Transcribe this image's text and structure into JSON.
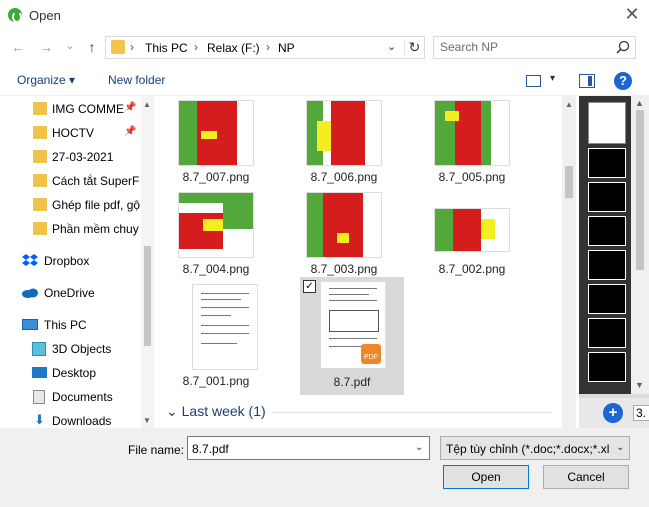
{
  "window": {
    "title": "Open",
    "close": "✕"
  },
  "nav": {
    "back": "←",
    "forward": "→",
    "recent": "⌄",
    "up": "↑"
  },
  "address": {
    "crumbs": [
      "This PC",
      "Relax (F:)",
      "NP"
    ],
    "sep": "›",
    "dropdown": "⌄",
    "refresh": "↻"
  },
  "search": {
    "placeholder": "Search NP"
  },
  "toolbar": {
    "organize": "Organize ▾",
    "new_folder": "New folder",
    "help": "?",
    "view_dd": "▾"
  },
  "sidebar": {
    "items": [
      {
        "label": "IMG COMME",
        "pinned": true
      },
      {
        "label": "HOCTV",
        "pinned": true
      },
      {
        "label": "27-03-2021",
        "pinned": false
      },
      {
        "label": "Cách tắt SuperFe",
        "pinned": false
      },
      {
        "label": "Ghép file pdf, gộ",
        "pinned": false
      },
      {
        "label": "Phần mềm chuy",
        "pinned": false
      },
      {
        "label": "Dropbox"
      },
      {
        "label": "OneDrive"
      },
      {
        "label": "This PC"
      },
      {
        "label": "3D Objects"
      },
      {
        "label": "Desktop"
      },
      {
        "label": "Documents"
      },
      {
        "label": "Downloads"
      }
    ],
    "pin_glyph": "📌",
    "scroll_up": "▲",
    "scroll_down": "▼"
  },
  "files": [
    {
      "name": "8.7_007.png",
      "kind": "sheet"
    },
    {
      "name": "8.7_006.png",
      "kind": "sheet"
    },
    {
      "name": "8.7_005.png",
      "kind": "sheet"
    },
    {
      "name": "8.7_004.png",
      "kind": "sheet"
    },
    {
      "name": "8.7_003.png",
      "kind": "sheet"
    },
    {
      "name": "8.7_002.png",
      "kind": "sheet"
    },
    {
      "name": "8.7_001.png",
      "kind": "doc"
    },
    {
      "name": "8.7.pdf",
      "kind": "pdf",
      "selected": true,
      "checked": "✓",
      "badge": "PDF"
    }
  ],
  "group": {
    "label": "Last week (1)",
    "chevron": "⌄"
  },
  "preview": {
    "zoom_plus": "+",
    "zoom_value": "3."
  },
  "bottom": {
    "file_name_label": "File name:",
    "file_name_value": "8.7.pdf",
    "file_type": "Tệp tùy chỉnh (*.doc;*.docx;*.xl",
    "dd": "⌄",
    "open_label": "Open",
    "cancel_label": "Cancel"
  },
  "colors": {
    "accent": "#1a66d4",
    "link": "#1a3e78",
    "folder": "#f2c34a",
    "pdf_badge": "#f0862a"
  }
}
